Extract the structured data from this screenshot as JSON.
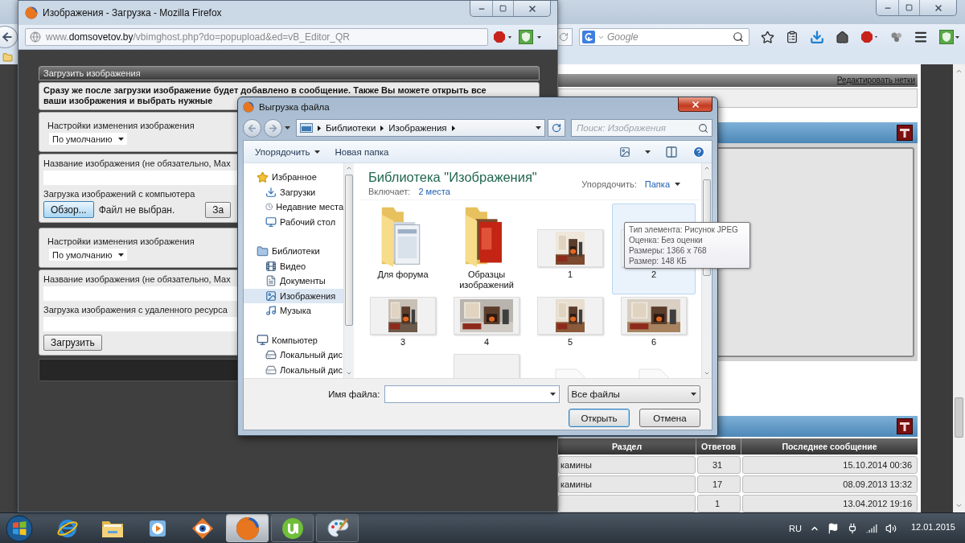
{
  "browser": {
    "search_placeholder": "Google",
    "tags_link": "Редактировать нетки",
    "table": {
      "columns": [
        "Раздел",
        "Ответов",
        "Последнее сообщение"
      ],
      "rows": [
        {
          "section": "камины",
          "replies": "31",
          "last_post": "15.10.2014 00:36"
        },
        {
          "section": "камины",
          "replies": "17",
          "last_post": "08.09.2013 13:32"
        },
        {
          "replies": "1",
          "last_post": "13.04.2012 19:16"
        }
      ]
    }
  },
  "popup": {
    "title": "Изображения - Загрузка - Mozilla Firefox",
    "url_prefix": "www.",
    "url_host": "domsovetov.by",
    "url_path": "/vbimghost.php?do=popupload&ed=vB_Editor_QR",
    "panel_title": "Загрузить изображения",
    "notice": [
      "Сразу же после загрузки изображение будет добавлено в сообщение. Также Вы можете открыть все",
      "ваши изображения и выбрать нужные"
    ],
    "sections": [
      {
        "kind": "computer",
        "settings_label": "Настройки изменения изображения",
        "resize_value": "По умолчанию",
        "name_label": "Название изображения (не обязательно, Мах",
        "source_label": "Загрузка изображений с компьютера",
        "browse_button": "Обзор...",
        "file_status": "Файл не выбран.",
        "upload_button": "За"
      },
      {
        "kind": "remote",
        "settings_label": "Настройки изменения изображения",
        "resize_value": "По умолчанию",
        "name_label": "Название изображения (не обязательно, Мах",
        "source_label": "Загрузка изображения с удаленного ресурса",
        "upload_button": "Загрузить"
      }
    ]
  },
  "dialog": {
    "title": "Выгрузка файла",
    "breadcrumb": [
      "Библиотеки",
      "Изображения"
    ],
    "search_placeholder": "Поиск: Изображения",
    "organize_button": "Упорядочить",
    "new_folder_button": "Новая папка",
    "nav": [
      {
        "label": "Избранное",
        "kind": "star",
        "selected": false,
        "children": [
          {
            "label": "Загрузки",
            "kind": "download",
            "selected": false
          },
          {
            "label": "Недавние места",
            "kind": "recent",
            "selected": false
          },
          {
            "label": "Рабочий стол",
            "kind": "desktop",
            "selected": false
          }
        ]
      },
      {
        "label": "Библиотеки",
        "kind": "library",
        "selected": false,
        "children": [
          {
            "label": "Видео",
            "kind": "video",
            "selected": false
          },
          {
            "label": "Документы",
            "kind": "docs",
            "selected": false
          },
          {
            "label": "Изображения",
            "kind": "images",
            "selected": true
          },
          {
            "label": "Музыка",
            "kind": "music",
            "selected": false
          }
        ]
      },
      {
        "label": "Компьютер",
        "kind": "computer",
        "selected": false,
        "children": [
          {
            "label": "Локальный дис",
            "kind": "disk",
            "selected": false
          },
          {
            "label": "Локальный дис",
            "kind": "drive",
            "selected": false
          }
        ]
      }
    ],
    "library_title": "Библиотека \"Изображения\"",
    "includes_label": "Включает:",
    "includes_link": "2 места",
    "arrange_label": "Упорядочить:",
    "arrange_value": "Папка",
    "items": [
      {
        "kind": "folder",
        "label": "Для форума",
        "hovered": false
      },
      {
        "kind": "album",
        "label": "Образцы изображений",
        "hovered": false
      },
      {
        "label": "1",
        "hovered": false
      },
      {
        "label": "2",
        "hovered": true
      },
      {
        "label": "3",
        "hovered": false
      },
      {
        "label": "4",
        "hovered": false
      },
      {
        "label": "5",
        "hovered": false
      },
      {
        "label": "6",
        "hovered": false
      },
      {
        "kind": "frame",
        "hovered": false
      },
      {
        "kind": "page",
        "hovered": false
      },
      {
        "kind": "page",
        "hovered": false
      }
    ],
    "tooltip": [
      "Тип элемента: Рисунок JPEG",
      "Оценка: Без оценки",
      "Размеры: 1366 x 768",
      "Размер: 148 КБ"
    ],
    "filename_label": "Имя файла:",
    "filetype": "Все файлы",
    "open_button": "Открыть",
    "cancel_button": "Отмена"
  },
  "taskbar": {
    "apps": [
      {
        "kind": "ie",
        "selected": false,
        "running": false
      },
      {
        "kind": "explorer",
        "selected": false,
        "running": false
      },
      {
        "kind": "media",
        "selected": false,
        "running": false
      },
      {
        "kind": "viewer",
        "selected": false,
        "running": false
      },
      {
        "kind": "firefox",
        "selected": true,
        "running": true
      },
      {
        "kind": "torrent",
        "selected": false,
        "running": true
      },
      {
        "kind": "paint",
        "selected": false,
        "running": true
      }
    ],
    "language": "RU",
    "date": "12.01.2015"
  }
}
